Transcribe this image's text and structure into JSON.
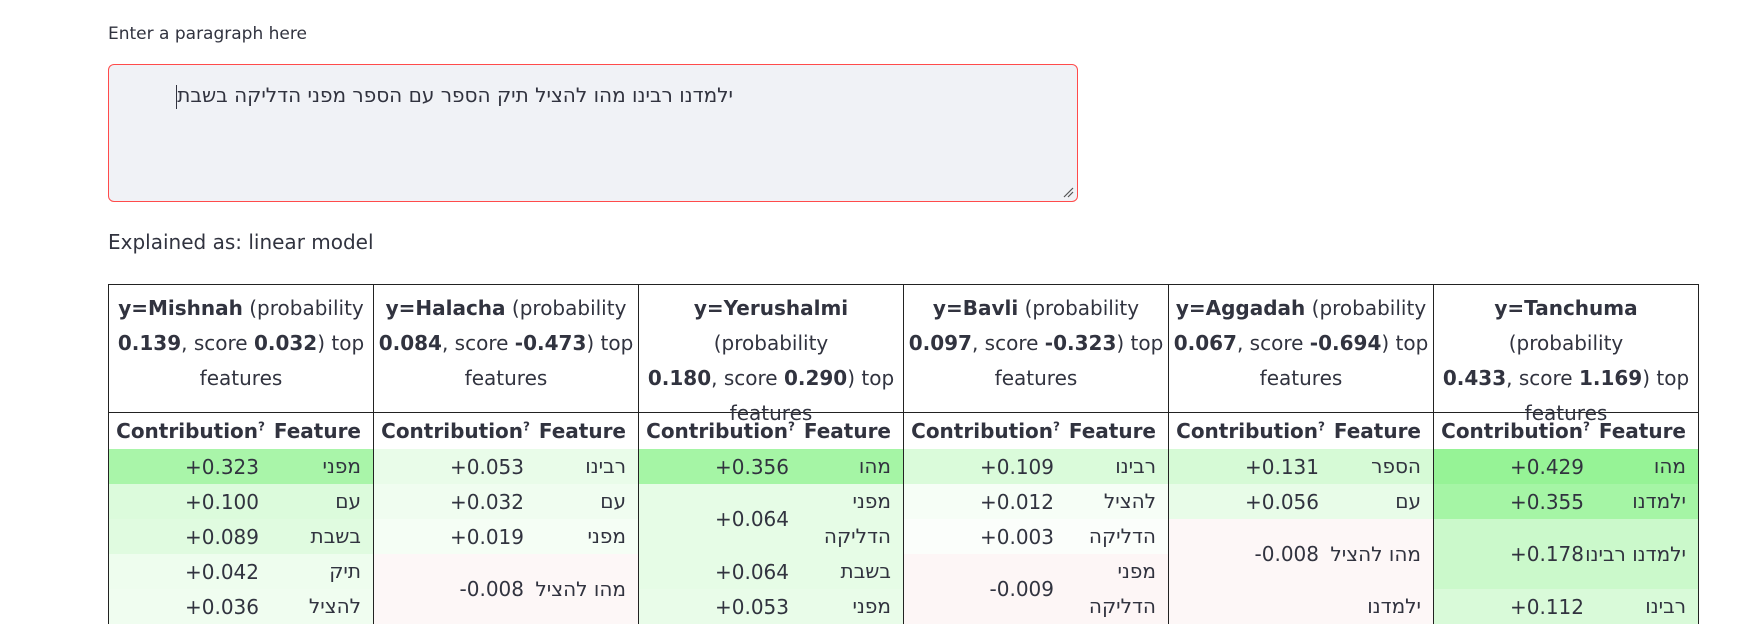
{
  "input": {
    "label": "Enter a paragraph here",
    "value": "ילמדנו רבינו מהו להציל תיק הספר עם הספר מפני הדליקה בשבת"
  },
  "explanation_label": "Explained as: linear model",
  "columns": [
    {
      "y": "y=Mishnah",
      "prob_text": "(probability",
      "probability": "0.139",
      "score_prefix": ", score",
      "score": "0.032",
      "suffix": ") top",
      "features_word": "features",
      "contribution_label": "Contribution",
      "help_mark": "?",
      "feature_label": "Feature",
      "rows": [
        {
          "value": "+0.323",
          "feature": "מפני",
          "color": "#a9f5a9",
          "height": 35
        },
        {
          "value": "+0.100",
          "feature": "עם",
          "color": "#dcfbdc",
          "height": 35
        },
        {
          "value": "+0.089",
          "feature": "בשבת",
          "color": "#e0fbe0",
          "height": 35
        },
        {
          "value": "+0.042",
          "feature": "תיק",
          "color": "#eefdee",
          "height": 35
        },
        {
          "value": "+0.036",
          "feature": "להציל",
          "color": "#f0fdf0",
          "height": 35
        }
      ]
    },
    {
      "y": "y=Halacha",
      "prob_text": "(probability",
      "probability": "0.084",
      "score_prefix": ", score",
      "score": "-0.473",
      "suffix": ") top",
      "features_word": "features",
      "contribution_label": "Contribution",
      "help_mark": "?",
      "feature_label": "Feature",
      "rows": [
        {
          "value": "+0.053",
          "feature": "רבינו",
          "color": "#e9fce9",
          "height": 35
        },
        {
          "value": "+0.032",
          "feature": "עם",
          "color": "#f0fdf0",
          "height": 35
        },
        {
          "value": "+0.019",
          "feature": "מפני",
          "color": "#f5fef5",
          "height": 35
        },
        {
          "value": "-0.008",
          "feature": "מהו להציל",
          "color": "#fdf7f7",
          "height": 70
        }
      ]
    },
    {
      "y": "y=Yerushalmi",
      "prob_text": "(probability",
      "probability": "0.180",
      "score_prefix": ", score",
      "score": "0.290",
      "suffix": ") top",
      "features_word": "features",
      "contribution_label": "Contribution",
      "help_mark": "?",
      "feature_label": "Feature",
      "rows": [
        {
          "value": "+0.356",
          "feature": "מהו",
          "color": "#a5f5a5",
          "height": 35
        },
        {
          "value": "+0.064",
          "feature": "מפני הדליקה",
          "color": "#e6fce6",
          "height": 70
        },
        {
          "value": "+0.064",
          "feature": "בשבת",
          "color": "#e6fce6",
          "height": 35
        },
        {
          "value": "+0.053",
          "feature": "מפני",
          "color": "#e9fce9",
          "height": 35
        }
      ]
    },
    {
      "y": "y=Bavli",
      "prob_text": "(probability",
      "probability": "0.097",
      "score_prefix": ", score",
      "score": "-0.323",
      "suffix": ") top",
      "features_word": "features",
      "contribution_label": "Contribution",
      "help_mark": "?",
      "feature_label": "Feature",
      "rows": [
        {
          "value": "+0.109",
          "feature": "רבינו",
          "color": "#dafbda",
          "height": 35
        },
        {
          "value": "+0.012",
          "feature": "להציל",
          "color": "#f6fef6",
          "height": 35
        },
        {
          "value": "+0.003",
          "feature": "הדליקה",
          "color": "#fbfefb",
          "height": 35
        },
        {
          "value": "-0.009",
          "feature": "מפני הדליקה",
          "color": "#fdf6f6",
          "height": 70
        }
      ]
    },
    {
      "y": "y=Aggadah",
      "prob_text": "(probability",
      "probability": "0.067",
      "score_prefix": ", score",
      "score": "-0.694",
      "suffix": ") top",
      "features_word": "features",
      "contribution_label": "Contribution",
      "help_mark": "?",
      "feature_label": "Feature",
      "rows": [
        {
          "value": "+0.131",
          "feature": "הספר",
          "color": "#d6fad6",
          "height": 35
        },
        {
          "value": "+0.056",
          "feature": "עם",
          "color": "#e8fce8",
          "height": 35
        },
        {
          "value": "-0.008",
          "feature": "מהו להציל",
          "color": "#fdf7f7",
          "height": 70
        },
        {
          "value": "",
          "feature": "ילמדנו",
          "color": "#fdf7f7",
          "height": 35
        }
      ]
    },
    {
      "y": "y=Tanchuma",
      "prob_text": "(probability",
      "probability": "0.433",
      "score_prefix": ", score",
      "score": "1.169",
      "suffix": ") top",
      "features_word": "features",
      "contribution_label": "Contribution",
      "help_mark": "?",
      "feature_label": "Feature",
      "rows": [
        {
          "value": "+0.429",
          "feature": "מהו",
          "color": "#96f396",
          "height": 35
        },
        {
          "value": "+0.355",
          "feature": "ילמדנו",
          "color": "#a5f5a5",
          "height": 35
        },
        {
          "value": "+0.178",
          "feature": "ילמדנו רבינו",
          "color": "#cbf9cb",
          "height": 70
        },
        {
          "value": "+0.112",
          "feature": "רבינו",
          "color": "#d9fad9",
          "height": 35
        }
      ]
    }
  ]
}
